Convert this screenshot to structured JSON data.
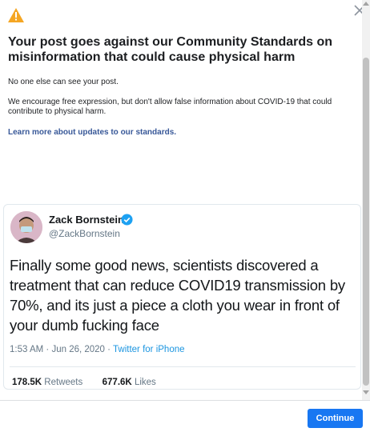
{
  "dialog": {
    "headline": "Your post goes against our Community Standards on misinformation that could cause physical harm",
    "private_notice": "No one else can see your post.",
    "policy_text": "We encourage free expression, but don't allow false information about COVID-19 that could contribute to physical harm.",
    "learn_more_link": "Learn more about updates to our standards.",
    "continue_label": "Continue",
    "warning_color": "#f5a623",
    "accent_color": "#1877f2"
  },
  "tweet": {
    "author_name": "Zack Bornstein",
    "author_handle": "@ZackBornstein",
    "verified": true,
    "text": "Finally some good news, scientists discovered a treatment that can reduce COVID19 transmission by 70%, and its just a piece a cloth you wear in front of your dumb fucking face",
    "time": "1:53 AM",
    "date": "Jun 26, 2020",
    "separator": "·",
    "source": "Twitter for iPhone",
    "retweets_count": "178.5K",
    "retweets_label": "Retweets",
    "likes_count": "677.6K",
    "likes_label": "Likes"
  },
  "icons": {
    "warning": "warning-triangle-icon",
    "close": "close-icon",
    "verified": "verified-badge-icon"
  }
}
